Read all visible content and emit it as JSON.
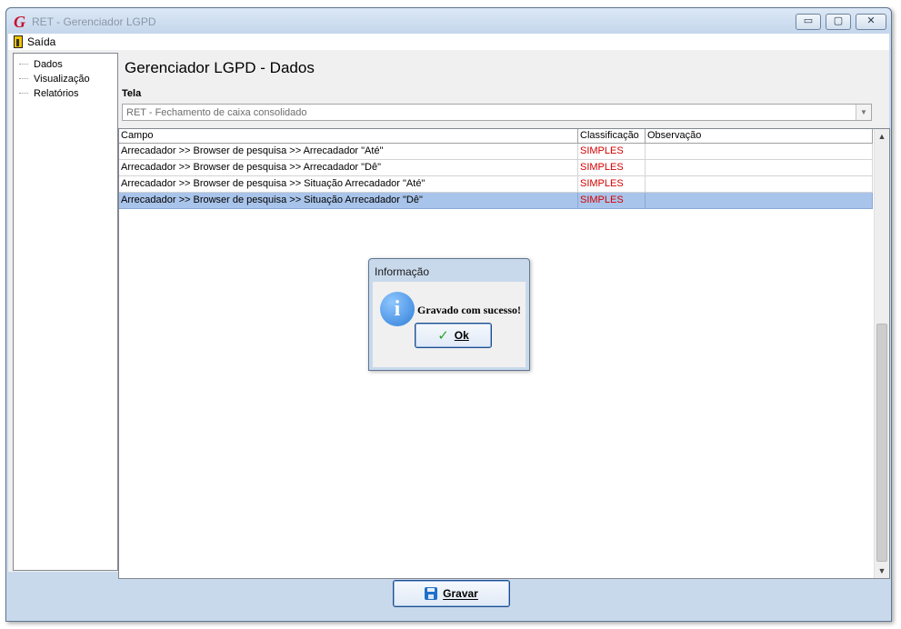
{
  "window": {
    "title": "RET - Gerenciador LGPD",
    "buttons": {
      "minimize": "▭",
      "maximize": "▢",
      "close": "✕"
    }
  },
  "menu": {
    "exit_label": "Saída",
    "exit_icon": "door-exit-icon"
  },
  "tree": {
    "items": [
      "Dados",
      "Visualização",
      "Relatórios"
    ]
  },
  "main": {
    "title": "Gerenciador LGPD - Dados",
    "tela_label": "Tela",
    "tela_value": "RET - Fechamento de caixa consolidado"
  },
  "grid": {
    "columns": [
      "Campo",
      "Classificação",
      "Observação"
    ],
    "rows": [
      {
        "campo": "Arrecadador >> Browser de pesquisa >> Arrecadador \"Até\"",
        "classificacao": "SIMPLES",
        "observacao": ""
      },
      {
        "campo": "Arrecadador >> Browser de pesquisa >> Arrecadador \"Dê\"",
        "classificacao": "SIMPLES",
        "observacao": ""
      },
      {
        "campo": "Arrecadador >> Browser de pesquisa >> Situação Arrecadador \"Até\"",
        "classificacao": "SIMPLES",
        "observacao": ""
      },
      {
        "campo": "Arrecadador >> Browser de pesquisa >> Situação Arrecadador \"Dê\"",
        "classificacao": "SIMPLES",
        "observacao": "",
        "selected": true
      }
    ]
  },
  "footer": {
    "save_label": "Gravar",
    "save_icon": "floppy-disk-icon"
  },
  "dialog": {
    "title": "Informação",
    "message": "Gravado com sucesso!",
    "ok_label": "Ok",
    "icon": "info-icon"
  },
  "colors": {
    "classification_text": "#d40000",
    "selected_row": "#a9c4ea",
    "window_frame": "#c9d9ec"
  }
}
